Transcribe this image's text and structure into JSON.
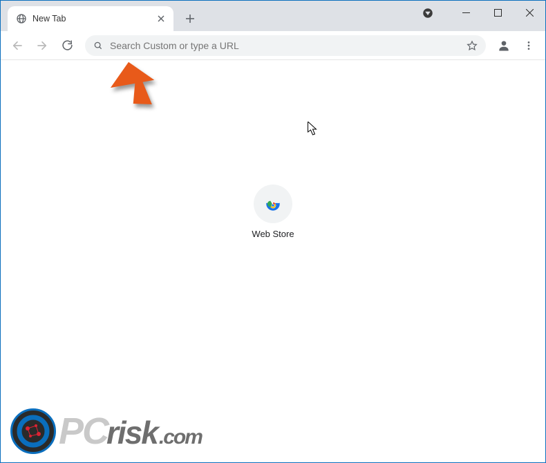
{
  "window": {
    "minimize": "–",
    "maximize": "□",
    "close": "×"
  },
  "tab": {
    "title": "New Tab"
  },
  "omnibox": {
    "placeholder": "Search Custom or type a URL"
  },
  "shortcuts": [
    {
      "label": "Web Store"
    }
  ],
  "watermark": {
    "pc": "PC",
    "risk": "risk",
    "com": ".com"
  }
}
